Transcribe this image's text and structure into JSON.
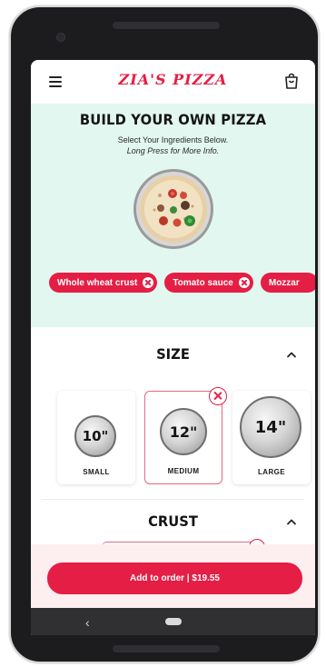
{
  "app": {
    "brand": "ZIA'S PIZZA"
  },
  "builder": {
    "title": "BUILD YOUR OWN PIZZA",
    "subtitle": "Select Your Ingredients Below.",
    "hint": "Long Press for More Info."
  },
  "chips": [
    {
      "label": "Whole wheat crust"
    },
    {
      "label": "Tomato sauce"
    },
    {
      "label": "Mozzar"
    }
  ],
  "size": {
    "title": "SIZE",
    "options": [
      {
        "value": "10\"",
        "label": "SMALL"
      },
      {
        "value": "12\"",
        "label": "MEDIUM"
      },
      {
        "value": "14\"",
        "label": "LARGE"
      }
    ],
    "selected": "MEDIUM"
  },
  "crust": {
    "title": "CRUST"
  },
  "footer": {
    "add_label": "Add to order | $19.55"
  },
  "nav": {
    "back_glyph": "‹"
  },
  "colors": {
    "brand": "#e41e44",
    "hero_bg": "#e2f7ef",
    "footer_bg": "#fdeef0"
  }
}
